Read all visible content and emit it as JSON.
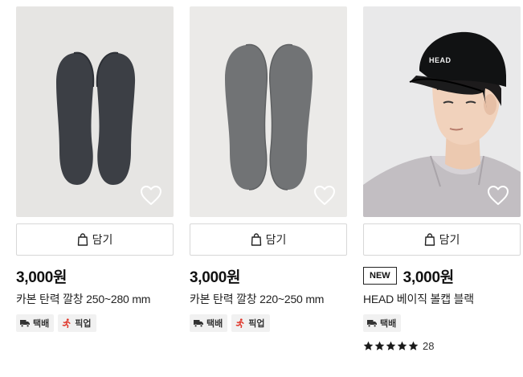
{
  "products": [
    {
      "price": "3,000원",
      "name": "카본 탄력 깔창 250~280 mm",
      "cart_label": "담기",
      "is_new": false,
      "badge": "",
      "tags": [
        {
          "icon": "delivery-truck-icon",
          "label": "택배"
        },
        {
          "icon": "pickup-runner-icon",
          "label": "픽업"
        }
      ],
      "image": {
        "subject": "dark-insoles",
        "bg": "#e6e5e3",
        "color": "#3c3f45"
      }
    },
    {
      "price": "3,000원",
      "name": "카본 탄력 깔창 220~250 mm",
      "cart_label": "담기",
      "is_new": false,
      "badge": "",
      "tags": [
        {
          "icon": "delivery-truck-icon",
          "label": "택배"
        },
        {
          "icon": "pickup-runner-icon",
          "label": "픽업"
        }
      ],
      "image": {
        "subject": "gray-insoles",
        "bg": "#ebeae8",
        "color": "#717375"
      }
    },
    {
      "price": "3,000원",
      "name": "HEAD 베이직 볼캡 블랙",
      "cart_label": "담기",
      "is_new": true,
      "badge": "NEW",
      "tags": [
        {
          "icon": "delivery-truck-icon",
          "label": "택배"
        }
      ],
      "rating": {
        "stars": 5,
        "max": 5,
        "count": "28"
      },
      "image": {
        "subject": "model-wearing-black-cap",
        "bg": "#e9e9ea",
        "cap_logo": "HEAD"
      }
    }
  ],
  "colors": {
    "text": "#111111",
    "tag_bg": "#f1f1f1",
    "pickup_icon": "#e03a2e",
    "border": "#d7d7d7"
  }
}
